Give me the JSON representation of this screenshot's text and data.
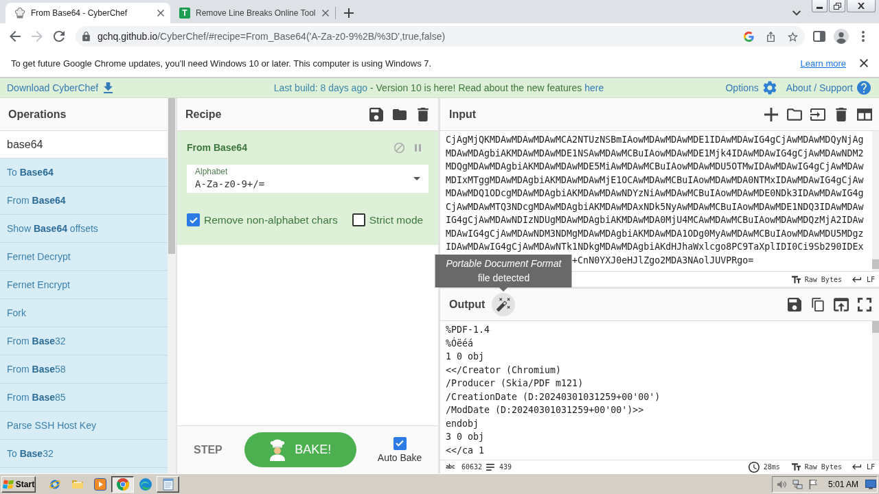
{
  "browser": {
    "tabs": [
      {
        "title": "From Base64 - CyberChef",
        "selected": true
      },
      {
        "title": "Remove Line Breaks Online Tool",
        "favicon": "T",
        "selected": false
      }
    ],
    "toolbar": {
      "back": {
        "disabled": false
      },
      "forward": {
        "disabled": true
      },
      "url_host": "gchq.github.io",
      "url_path": "/CyberChef/#recipe=From_Base64('A-Za-z0-9%2B/%3D',true,false)"
    },
    "infobar": {
      "message": "To get future Google Chrome updates, you'll need Windows 10 or later. This computer is using Windows 7.",
      "link": "Learn more"
    }
  },
  "banner": {
    "download": "Download CyberChef",
    "build": "Last build: 8 days ago",
    "notice": "- Version 10 is here! Read about the new features",
    "notice_link": "here",
    "options": "Options",
    "support": "About / Support"
  },
  "operations": {
    "title": "Operations",
    "search": {
      "value": "base64"
    },
    "items": [
      "To **Base64**",
      "From **Base64**",
      "Show **Base64** offsets",
      "Fernet Decrypt",
      "Fernet Encrypt",
      "Fork",
      "From **Base**32",
      "From **Base**58",
      "From **Base**85",
      "Parse SSH Host Key",
      "To **Base**32"
    ]
  },
  "recipe": {
    "title": "Recipe",
    "operations": [
      {
        "name": "From Base64",
        "args": [
          {
            "kind": "dropdown",
            "label": "Alphabet",
            "value": "A-Za-z0-9+/="
          },
          {
            "kind": "checkbox",
            "label": "Remove non-alphabet chars",
            "checked": true
          },
          {
            "kind": "checkbox",
            "label": "Strict mode",
            "checked": false
          }
        ]
      }
    ],
    "step": "STEP",
    "bake": "BAKE!",
    "auto_bake": {
      "label": "Auto Bake",
      "checked": true
    }
  },
  "input": {
    "title": "Input",
    "lines": [
      "CjAgMjQKMDAwMDAwMDAwMCA2NTUzNSBmIAowMDAwMDAwMDE1IDAwMDAwIG4gCjAwMDAwMDQyNjAg",
      "MDAwMDAgbiAKMDAwMDAwMDE1NSAwMDAwMCBuIAowMDAwMDE1Mjk4IDAwMDAwIG4gCjAwMDAwNDM2",
      "MDQgMDAwMDAgbiAKMDAwMDAwMDE5MiAwMDAwMCBuIAowMDAwMDU5OTMwIDAwMDAwIG4gCjAwMDAw",
      "MDIxMTggMDAwMDAgbiAKMDAwMDAwMjE1OCAwMDAwMCBuIAowMDAwMDA0NTMxIDAwMDAwIG4gCjAw",
      "MDAwMDQ1ODcgMDAwMDAgbiAKMDAwMDAwNDYzNiAwMDAwMCBuIAowMDAwMDE0NDk3IDAwMDAwIG4g",
      "CjAwMDAwMTQ3NDcgMDAwMDAgbiAKMDAwMDAxNDk5NyAwMDAwMCBuIAowMDAwMDE1NDQ3IDAwMDAw",
      "IG4gCjAwMDAwNDIzNDUgMDAwMDAgbiAKMDAwMDA0MjU4MCAwMDAwMCBuIAowMDAwMDQzMjA2IDAw",
      "MDAwIG4gCjAwMDAwNDM3NDMgMDAwMDAgbiAKMDAwMDA1ODg0MyAwMDAwMCBuIAowMDAwMDU5MDgz",
      "IDAwMDAwIG4gCjAwMDAwNTk1NDkgMDAwMDAgbiAKdHJhaWxlcgo8PC9TaXplIDI0Ci9Sb290IDEx"
    ],
    "partial_line": "+CnN0YXJ0eHJlZgo2MDA3NAolJUVPRgo=",
    "status": {
      "format": "Raw Bytes",
      "eol": "LF"
    }
  },
  "output": {
    "title": "Output",
    "magic_tooltip": "*Portable Document Format* file detected",
    "lines": [
      "%PDF-1.4",
      "%Óëéá",
      "1 0 obj",
      "<</Creator (Chromium)",
      "/Producer (Skia/PDF m121)",
      "/CreationDate (D:20240301031259+00'00')",
      "/ModDate (D:20240301031259+00'00')>>",
      "endobj",
      "3 0 obj",
      "<</ca 1"
    ],
    "status": {
      "length_icon": "abc",
      "length": "60632",
      "lines": "439",
      "time": "28ms",
      "format": "Raw Bytes",
      "eol": "LF"
    }
  },
  "taskbar": {
    "start": "Start",
    "apps": [
      {
        "kind": "ie",
        "open": false,
        "selected": false
      },
      {
        "kind": "explorer",
        "open": false,
        "selected": false
      },
      {
        "kind": "player",
        "open": false,
        "selected": false
      },
      {
        "kind": "chrome",
        "open": true,
        "selected": true
      },
      {
        "kind": "edge",
        "open": false,
        "selected": false
      },
      {
        "kind": "notepad",
        "open": true,
        "selected": false
      }
    ],
    "clock": "5:01 AM"
  }
}
